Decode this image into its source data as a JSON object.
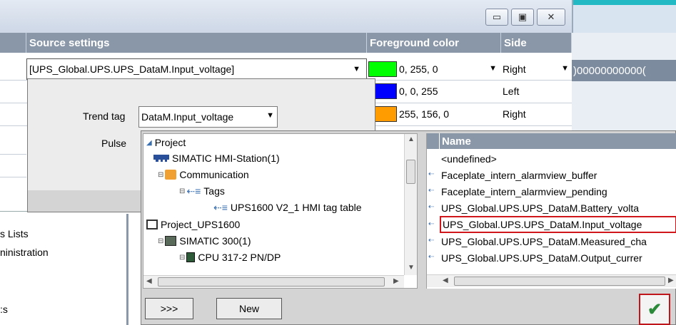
{
  "window": {
    "minimize_glyph": "▭",
    "maximize_glyph": "▣",
    "close_glyph": "✕"
  },
  "table": {
    "headers": {
      "source": "Source settings",
      "fg": "Foreground color",
      "side": "Side"
    },
    "rows": [
      {
        "source": "[UPS_Global.UPS.UPS_DataM.Input_voltage]",
        "color": "#00ff00",
        "color_label": "0, 255, 0",
        "side": "Right"
      },
      {
        "source": "",
        "color": "#0000ff",
        "color_label": "0, 0, 255",
        "side": "Left"
      },
      {
        "source": "",
        "color": "#ff9c00",
        "color_label": "255, 156, 0",
        "side": "Right"
      }
    ],
    "right_overflow_text": ")00000000000("
  },
  "popup": {
    "trend_tag_label": "Trend tag",
    "trend_tag_value": "DataM.Input_voltage",
    "pulse_label": "Pulse"
  },
  "tree": {
    "items": [
      {
        "label": "Project",
        "icon": "project-icon"
      },
      {
        "label": "SIMATIC HMI-Station(1)",
        "icon": "hmi-station-icon"
      },
      {
        "label": "Communication",
        "icon": "communication-icon"
      },
      {
        "label": "Tags",
        "icon": "tags-icon"
      },
      {
        "label": "UPS1600 V2_1 HMI tag table",
        "icon": "tag-table-icon"
      },
      {
        "label": "Project_UPS1600",
        "icon": "project-folder-icon"
      },
      {
        "label": "SIMATIC 300(1)",
        "icon": "plc-station-icon"
      },
      {
        "label": "CPU 317-2 PN/DP",
        "icon": "cpu-icon"
      }
    ]
  },
  "taglist": {
    "header": "Name",
    "items": [
      "<undefined>",
      "Faceplate_intern_alarmview_buffer",
      "Faceplate_intern_alarmview_pending",
      "UPS_Global.UPS.UPS_DataM.Battery_volta",
      "UPS_Global.UPS.UPS_DataM.Input_voltage",
      "UPS_Global.UPS.UPS_DataM.Measured_cha",
      "UPS_Global.UPS.UPS_DataM.Output_currer"
    ],
    "selected_index": 4
  },
  "buttons": {
    "expand": ">>>",
    "new": "New",
    "ok_glyph": "✔"
  },
  "left_panel": {
    "items": [
      "s Lists",
      "ninistration",
      ":s"
    ]
  },
  "colors": {
    "header_bg": "#8a97a8",
    "highlight": "#d0161b",
    "ok_check": "#2a8a3a"
  }
}
